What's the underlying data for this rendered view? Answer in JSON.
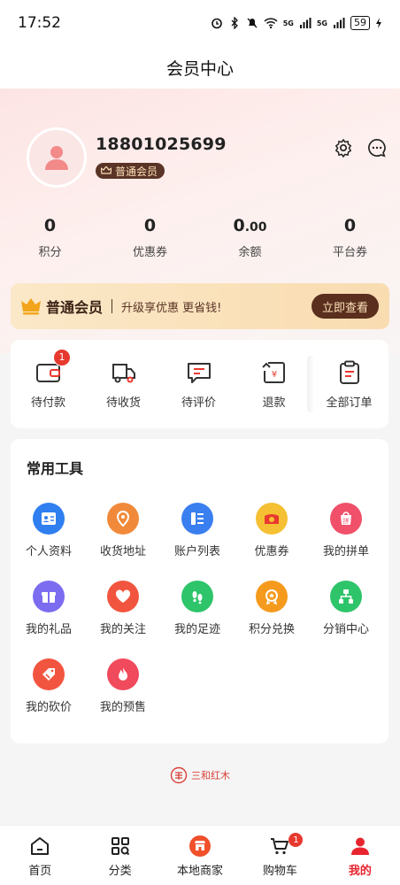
{
  "status_bar": {
    "time": "17:52",
    "battery": "59",
    "net1": "5G",
    "net2": "5G"
  },
  "title": "会员中心",
  "profile": {
    "phone": "18801025699",
    "member_level": "普通会员"
  },
  "stats": [
    {
      "value": "0",
      "label": "积分"
    },
    {
      "value": "0",
      "label": "优惠券"
    },
    {
      "value_main": "0",
      "value_dec": ".00",
      "label": "余额"
    },
    {
      "value": "0",
      "label": "平台券"
    }
  ],
  "vip": {
    "title": "普通会员",
    "desc": "升级享优惠 更省钱!",
    "button": "立即查看"
  },
  "orders": [
    {
      "label": "待付款",
      "badge": "1",
      "icon": "wallet-icon"
    },
    {
      "label": "待收货",
      "icon": "truck-icon"
    },
    {
      "label": "待评价",
      "icon": "comment-icon"
    },
    {
      "label": "退款",
      "icon": "refund-icon"
    },
    {
      "label": "全部订单",
      "icon": "clipboard-icon"
    }
  ],
  "tools": {
    "title": "常用工具",
    "items": [
      {
        "label": "个人资料",
        "icon": "id-card-icon",
        "color": "#2f7ff0"
      },
      {
        "label": "收货地址",
        "icon": "location-pin-icon",
        "color": "#f08a3a"
      },
      {
        "label": "账户列表",
        "icon": "list-icon",
        "color": "#3a7ff0"
      },
      {
        "label": "优惠券",
        "icon": "coupon-icon",
        "color": "#f5c033"
      },
      {
        "label": "我的拼单",
        "icon": "group-buy-icon",
        "color": "#f0506a"
      },
      {
        "label": "我的礼品",
        "icon": "gift-icon",
        "color": "#7b6cf0"
      },
      {
        "label": "我的关注",
        "icon": "heart-icon",
        "color": "#f2553f"
      },
      {
        "label": "我的足迹",
        "icon": "footprint-icon",
        "color": "#2ec46a"
      },
      {
        "label": "积分兑换",
        "icon": "medal-icon",
        "color": "#f59a1c"
      },
      {
        "label": "分销中心",
        "icon": "hierarchy-icon",
        "color": "#2ec46a"
      },
      {
        "label": "我的砍价",
        "icon": "bargain-tag-icon",
        "color": "#f2553f"
      },
      {
        "label": "我的预售",
        "icon": "flame-icon",
        "color": "#f04a5c"
      }
    ]
  },
  "brand": "三和红木",
  "bottom_nav": [
    {
      "label": "首页",
      "icon": "home-icon"
    },
    {
      "label": "分类",
      "icon": "category-icon"
    },
    {
      "label": "本地商家",
      "icon": "store-icon"
    },
    {
      "label": "购物车",
      "icon": "cart-icon",
      "badge": "1"
    },
    {
      "label": "我的",
      "icon": "user-icon",
      "active": true
    }
  ],
  "colors": {
    "accent": "#e8252f",
    "vip_dark": "#5a2f1e",
    "vip_light": "#fbe0b8"
  }
}
